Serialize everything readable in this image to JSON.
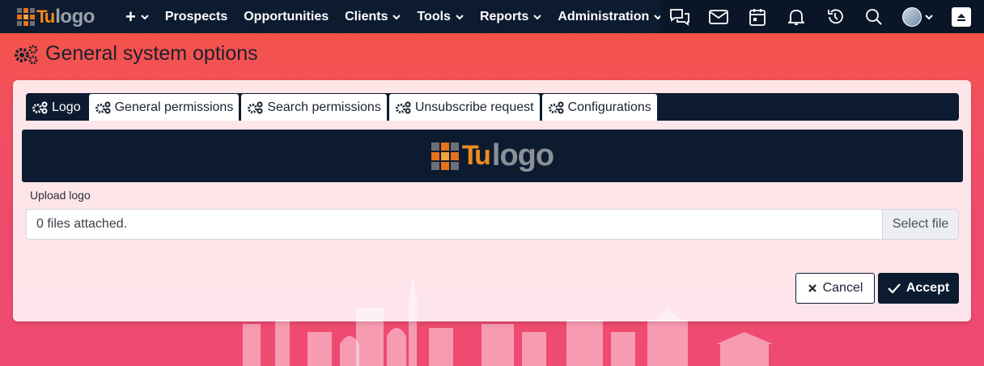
{
  "app": {
    "brand_prefix": "Tu",
    "brand_name": "logo"
  },
  "nav": {
    "add_label": "+",
    "items": [
      {
        "label": "Prospects"
      },
      {
        "label": "Opportunities"
      },
      {
        "label": "Clients"
      },
      {
        "label": "Tools"
      },
      {
        "label": "Reports"
      },
      {
        "label": "Administration"
      }
    ],
    "icons": [
      "chat-icon",
      "mail-icon",
      "calendar-icon",
      "bell-icon",
      "history-icon",
      "search-icon"
    ]
  },
  "page": {
    "title": "General system options"
  },
  "tabs": [
    {
      "label": "Logo",
      "active": true
    },
    {
      "label": "General permissions",
      "active": false
    },
    {
      "label": "Search permissions",
      "active": false
    },
    {
      "label": "Unsubscribe request",
      "active": false
    },
    {
      "label": "Configurations",
      "active": false
    }
  ],
  "logo_preview": {
    "prefix": "Tu",
    "name": "logo"
  },
  "upload": {
    "label": "Upload logo",
    "status": "0 files attached.",
    "button": "Select file"
  },
  "actions": {
    "cancel": "Cancel",
    "accept": "Accept"
  },
  "colors": {
    "navy": "#0d1b30",
    "brand_orange": "#f08a1c",
    "background": "#f04a6c"
  }
}
